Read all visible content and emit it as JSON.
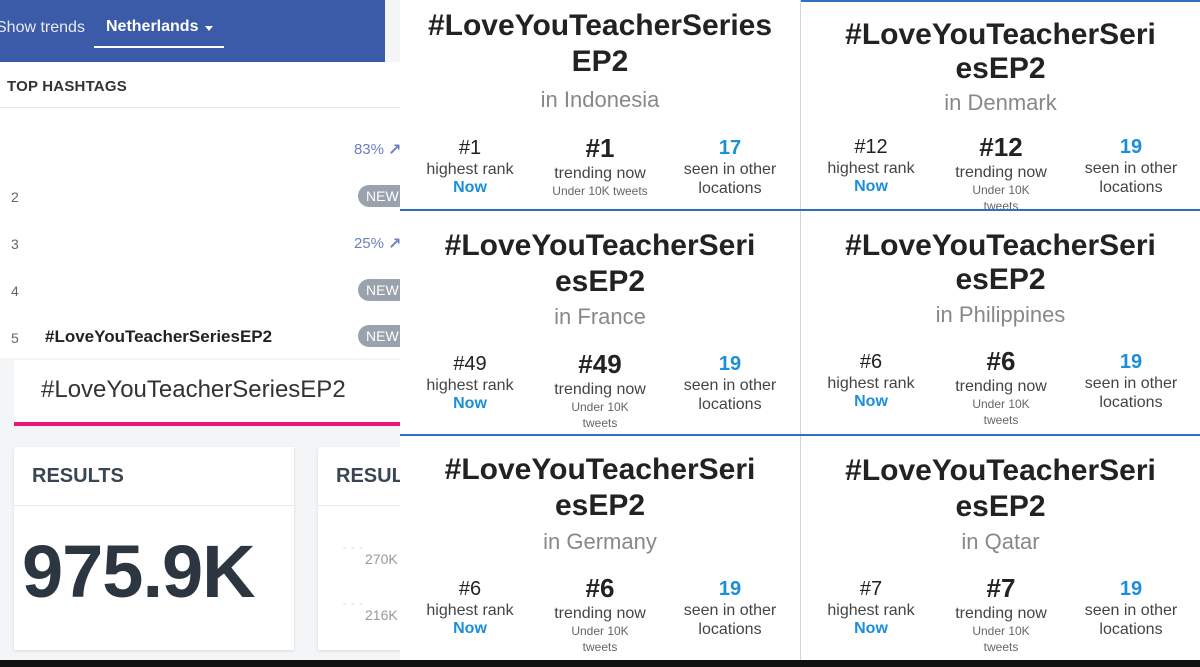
{
  "header": {
    "show_trends": "Show trends",
    "country": "Netherlands"
  },
  "top_hashtags": {
    "title": "TOP HASHTAGS",
    "rows": [
      {
        "rank": "",
        "tag": "",
        "pct": "83%",
        "badge": ""
      },
      {
        "rank": "2",
        "tag": "",
        "pct": "",
        "badge": "NEW"
      },
      {
        "rank": "3",
        "tag": "",
        "pct": "25%",
        "badge": ""
      },
      {
        "rank": "4",
        "tag": "",
        "pct": "",
        "badge": "NEW"
      },
      {
        "rank": "5",
        "tag": "#LoveYouTeacherSeriesEP2",
        "pct": "",
        "badge": "NEW"
      }
    ]
  },
  "search": {
    "value": "#LoveYouTeacherSeriesEP2"
  },
  "results": {
    "label": "RESULTS",
    "value": "975.9K",
    "label2": "RESUL",
    "axis": [
      "270K",
      "216K"
    ]
  },
  "cards": [
    {
      "title1": "#LoveYouTeacherSeries",
      "title2": "EP2",
      "location": "in Indonesia",
      "highest": "#1",
      "highest_label": "highest rank",
      "now": "Now",
      "trending": "#1",
      "trending_label": "trending now",
      "trending_sub": "Under 10K tweets",
      "seen": "17",
      "seen_label1": "seen in other",
      "seen_label2": "locations"
    },
    {
      "title1": "#LoveYouTeacherSeri",
      "title2": "esEP2",
      "location": "in Denmark",
      "highest": "#12",
      "highest_label": "highest rank",
      "now": "Now",
      "trending": "#12",
      "trending_label": "trending now",
      "trending_sub": "Under 10K tweets",
      "seen": "19",
      "seen_label1": "seen in other",
      "seen_label2": "locations"
    },
    {
      "title1": "#LoveYouTeacherSeri",
      "title2": "esEP2",
      "location": "in France",
      "highest": "#49",
      "highest_label": "highest rank",
      "now": "Now",
      "trending": "#49",
      "trending_label": "trending now",
      "trending_sub": "Under 10K tweets",
      "seen": "19",
      "seen_label1": "seen in other",
      "seen_label2": "locations"
    },
    {
      "title1": "#LoveYouTeacherSeri",
      "title2": "esEP2",
      "location": "in Philippines",
      "highest": "#6",
      "highest_label": "highest rank",
      "now": "Now",
      "trending": "#6",
      "trending_label": "trending now",
      "trending_sub": "Under 10K tweets",
      "seen": "19",
      "seen_label1": "seen in other",
      "seen_label2": "locations"
    },
    {
      "title1": "#LoveYouTeacherSeri",
      "title2": "esEP2",
      "location": "in Germany",
      "highest": "#6",
      "highest_label": "highest rank",
      "now": "Now",
      "trending": "#6",
      "trending_label": "trending now",
      "trending_sub": "Under 10K tweets",
      "seen": "19",
      "seen_label1": "seen in other",
      "seen_label2": "locations"
    },
    {
      "title1": "#LoveYouTeacherSeri",
      "title2": "esEP2",
      "location": "in Qatar",
      "highest": "#7",
      "highest_label": "highest rank",
      "now": "Now",
      "trending": "#7",
      "trending_label": "trending now",
      "trending_sub": "Under 10K tweets",
      "seen": "19",
      "seen_label1": "seen in other",
      "seen_label2": "locations"
    }
  ],
  "colors": {
    "header_blue": "#3b5aa8",
    "accent_pink": "#e6197a",
    "link_blue": "#1a8fdc",
    "separator_blue": "#2f6fbe"
  }
}
